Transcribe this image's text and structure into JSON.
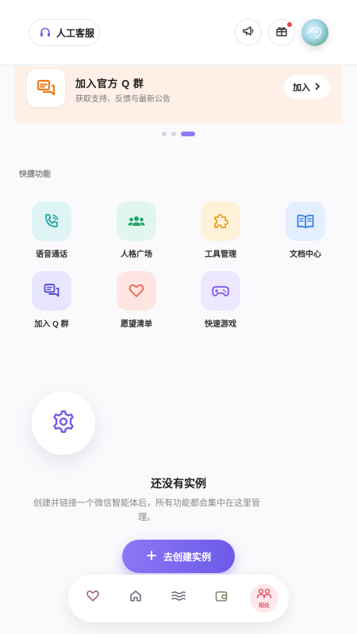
{
  "header": {
    "support_label": "人工客服",
    "icons": [
      "headset-icon",
      "megaphone-icon",
      "gift-icon"
    ],
    "has_notification": true
  },
  "banner": {
    "title": "加入官方 Q 群",
    "subtitle": "获取支持、反馈与最新公告",
    "join_label": "加入",
    "background": "#fff0e7",
    "icon_color": "#ee7a16"
  },
  "carousel": {
    "count": 3,
    "active_index": 2
  },
  "quick": {
    "label": "快捷功能",
    "items": [
      {
        "label": "语音通话",
        "icon": "phone-call-icon",
        "bg": "#dff5f5",
        "color": "#1fa7a5"
      },
      {
        "label": "人格广场",
        "icon": "people-icon",
        "bg": "#e1f6ec",
        "color": "#21a56a"
      },
      {
        "label": "工具管理",
        "icon": "puzzle-icon",
        "bg": "#fff1d7",
        "color": "#e3a020"
      },
      {
        "label": "文档中心",
        "icon": "book-icon",
        "bg": "#e3efff",
        "color": "#3b7fe0"
      },
      {
        "label": "加入 Q 群",
        "icon": "chat-icon",
        "bg": "#e8e6ff",
        "color": "#5a4fcf"
      },
      {
        "label": "愿望清单",
        "icon": "heart-icon",
        "bg": "#ffe5e1",
        "color": "#e56a55"
      },
      {
        "label": "快速游戏",
        "icon": "gamepad-icon",
        "bg": "#ede7ff",
        "color": "#7a5ae6"
      }
    ]
  },
  "empty_state": {
    "title": "还没有实例",
    "description": "创建并链接一个微信智能体后，所有功能都会集中在这里管理。",
    "create_label": "去创建实例",
    "accent": "#7a66f0"
  },
  "bottom_nav": {
    "items": [
      "heart-icon",
      "home-icon",
      "waves-icon",
      "wallet-icon",
      "friends-icon"
    ],
    "active_label": "相处",
    "active_color": "#e45a6a"
  }
}
